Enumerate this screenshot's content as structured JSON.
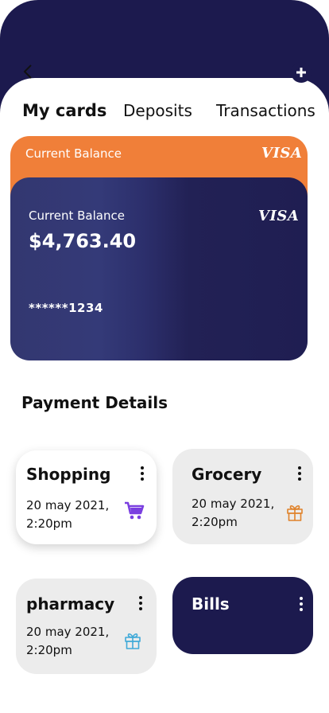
{
  "tabs": [
    {
      "label": "My  cards",
      "active": true
    },
    {
      "label": "Deposits",
      "active": false
    },
    {
      "label": "Transactions",
      "active": false
    }
  ],
  "card_back": {
    "label": "Current Balance",
    "brand": "VISA",
    "color": "#f07f39"
  },
  "card_front": {
    "label": "Current Balance",
    "amount": "$4,763.40",
    "brand": "VISA",
    "number": "******1234"
  },
  "section_title": "Payment Details",
  "payments": [
    {
      "title": "Shopping",
      "date_line1": "20 may 2021,",
      "date_line2": "2:20pm",
      "icon": "cart-icon",
      "icon_color": "#7a3fe0"
    },
    {
      "title": "Grocery",
      "date_line1": "20 may 2021,",
      "date_line2": "2:20pm",
      "icon": "gift-icon",
      "icon_color": "#e0822a"
    },
    {
      "title": "pharmacy",
      "date_line1": "20 may 2021,",
      "date_line2": "2:20pm",
      "icon": "gift-icon",
      "icon_color": "#3fa9d8"
    },
    {
      "title": "Bills"
    }
  ],
  "colors": {
    "header": "#1c1a4e",
    "accent": "#f07f39",
    "tile": "#ececec"
  }
}
